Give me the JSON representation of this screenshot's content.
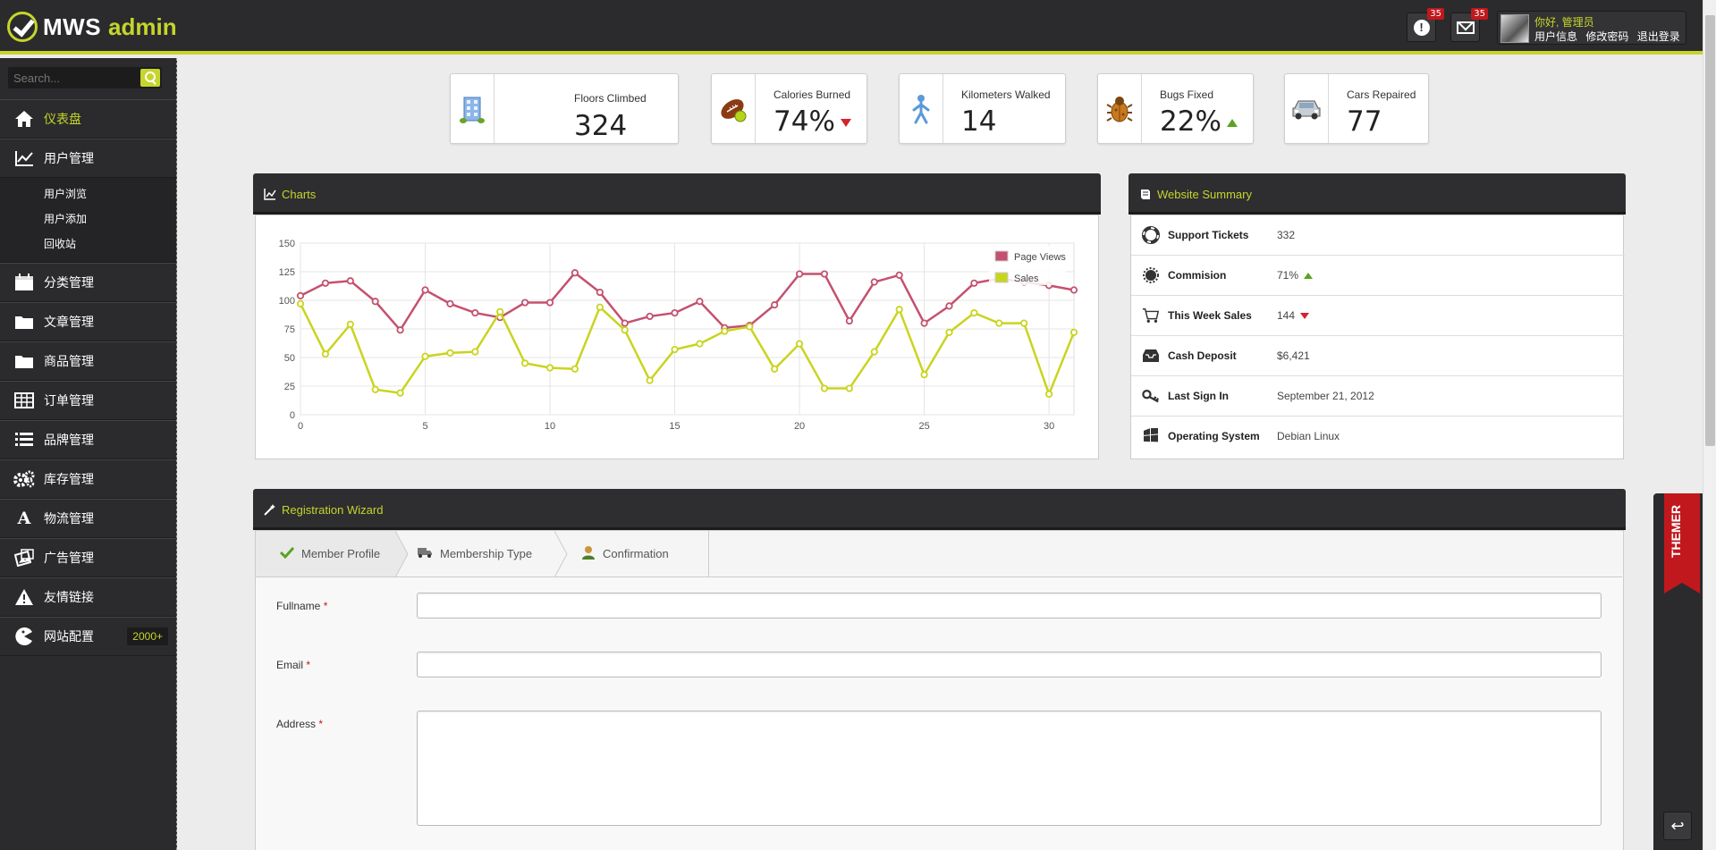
{
  "app": {
    "logo_main": "MWS",
    "logo_sub": "admin"
  },
  "header": {
    "alerts_count": "35",
    "messages_count": "35",
    "greeting": "你好, 管理员",
    "links": [
      "用户信息",
      "修改密码",
      "退出登录"
    ]
  },
  "search": {
    "placeholder": "Search..."
  },
  "sidebar": {
    "items": [
      {
        "label": "仪表盘",
        "icon": "home-icon"
      },
      {
        "label": "用户管理",
        "icon": "line-chart-icon"
      },
      {
        "label": "分类管理",
        "icon": "calendar-icon"
      },
      {
        "label": "文章管理",
        "icon": "folder-icon"
      },
      {
        "label": "商品管理",
        "icon": "folder-icon"
      },
      {
        "label": "订单管理",
        "icon": "table-icon"
      },
      {
        "label": "品牌管理",
        "icon": "list-icon"
      },
      {
        "label": "库存管理",
        "icon": "gears-icon"
      },
      {
        "label": "物流管理",
        "icon": "font-icon"
      },
      {
        "label": "广告管理",
        "icon": "images-icon"
      },
      {
        "label": "友情链接",
        "icon": "warning-icon"
      },
      {
        "label": "网站配置",
        "icon": "pacman-icon",
        "count": "2000+"
      }
    ],
    "sub_items": [
      "用户浏览",
      "用户添加",
      "回收站"
    ]
  },
  "stats": [
    {
      "label": "Floors Climbed",
      "value": "324"
    },
    {
      "label": "Calories Burned",
      "value": "74%",
      "trend": "down"
    },
    {
      "label": "Kilometers Walked",
      "value": "14"
    },
    {
      "label": "Bugs Fixed",
      "value": "22%",
      "trend": "up"
    },
    {
      "label": "Cars Repaired",
      "value": "77"
    }
  ],
  "charts_panel": {
    "title": "Charts"
  },
  "chart_data": {
    "type": "line",
    "x": [
      0,
      1,
      2,
      3,
      4,
      5,
      6,
      7,
      8,
      9,
      10,
      11,
      12,
      13,
      14,
      15,
      16,
      17,
      18,
      19,
      20,
      21,
      22,
      23,
      24,
      25,
      26,
      27,
      28,
      29,
      30,
      31
    ],
    "series": [
      {
        "name": "Page Views",
        "color": "#c4516f",
        "values": [
          104,
          115,
          117,
          99,
          74,
          109,
          97,
          89,
          85,
          98,
          98,
          124,
          107,
          80,
          86,
          89,
          99,
          76,
          78,
          96,
          123,
          123,
          82,
          116,
          122,
          80,
          95,
          115,
          119,
          116,
          113,
          109
        ]
      },
      {
        "name": "Sales",
        "color": "#c9d41f",
        "values": [
          97,
          53,
          79,
          22,
          19,
          51,
          54,
          55,
          90,
          45,
          41,
          40,
          94,
          74,
          30,
          57,
          62,
          73,
          77,
          40,
          62,
          23,
          23,
          55,
          92,
          35,
          72,
          89,
          80,
          80,
          18,
          72
        ]
      }
    ],
    "xlim": [
      0,
      31
    ],
    "ylim": [
      0,
      150
    ],
    "xticks": [
      0,
      5,
      10,
      15,
      20,
      25,
      30
    ],
    "yticks": [
      0,
      25,
      50,
      75,
      100,
      125,
      150
    ],
    "grid": true,
    "legend": "top-right"
  },
  "summary": {
    "title": "Website Summary",
    "rows": [
      {
        "label": "Support Tickets",
        "value": "332",
        "icon": "lifebuoy-icon"
      },
      {
        "label": "Commision",
        "value": "71%",
        "trend": "up",
        "icon": "badge-icon"
      },
      {
        "label": "This Week Sales",
        "value": "144",
        "trend": "down",
        "icon": "cart-icon"
      },
      {
        "label": "Cash Deposit",
        "value": "$6,421",
        "icon": "inbox-icon"
      },
      {
        "label": "Last Sign In",
        "value": "September 21, 2012",
        "icon": "key-icon"
      },
      {
        "label": "Operating System",
        "value": "Debian Linux",
        "icon": "windows-icon"
      }
    ]
  },
  "wizard": {
    "title": "Registration Wizard",
    "steps": [
      "Member Profile",
      "Membership Type",
      "Confirmation"
    ],
    "fields": [
      {
        "label": "Fullname",
        "required": "*",
        "value": ""
      },
      {
        "label": "Email",
        "required": "*",
        "value": ""
      },
      {
        "label": "Address",
        "required": "*",
        "value": ""
      }
    ]
  },
  "themer": {
    "label": "THEMER"
  },
  "colors": {
    "accent": "#c5d52b",
    "header_bg": "#2b2b2d",
    "badge_red": "#c1181d"
  }
}
